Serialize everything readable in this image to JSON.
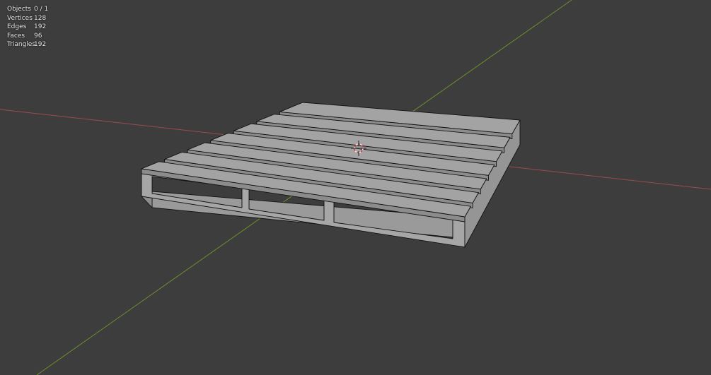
{
  "overlay": {
    "stats": [
      {
        "label": "Objects",
        "value": "0 / 1"
      },
      {
        "label": "Vertices",
        "value": "128"
      },
      {
        "label": "Edges",
        "value": "192"
      },
      {
        "label": "Faces",
        "value": "96"
      },
      {
        "label": "Triangles",
        "value": "192"
      }
    ]
  },
  "colors": {
    "background": "#3d3d3d",
    "x_axis": "#9b4a52",
    "y_axis": "#6a8f2c",
    "mesh_top": "#a3a3a3",
    "mesh_side": "#9a9a9a",
    "mesh_edge": "#111111"
  },
  "icons": [
    "3d-cursor-icon"
  ]
}
